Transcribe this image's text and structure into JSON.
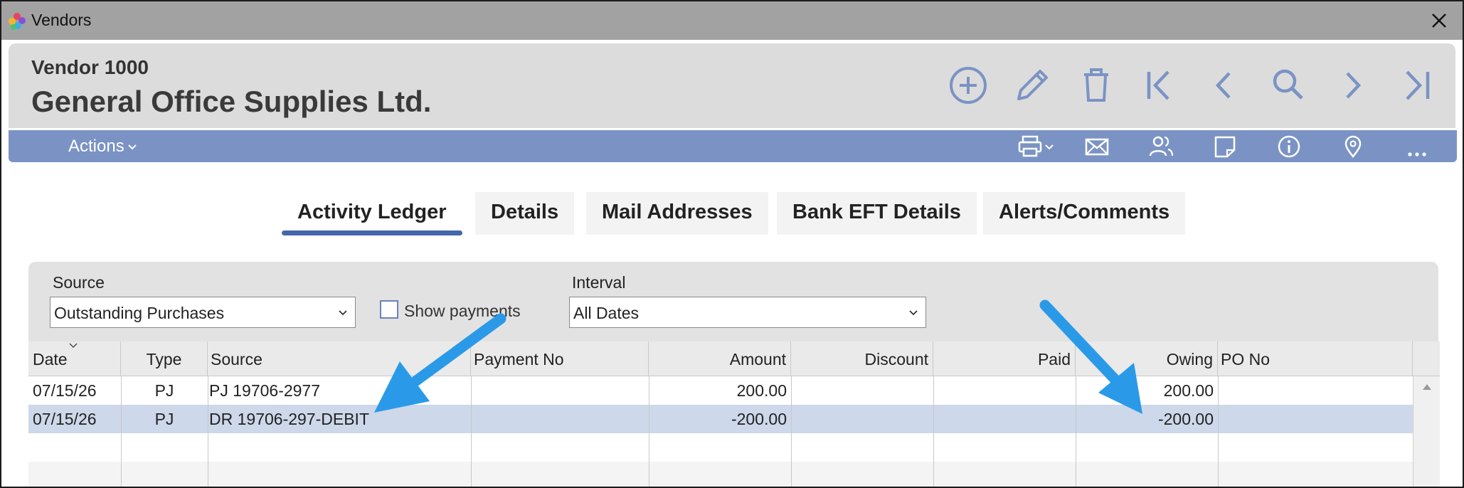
{
  "window": {
    "title": "Vendors"
  },
  "header": {
    "vendor_number": "Vendor 1000",
    "vendor_name": "General Office Supplies Ltd."
  },
  "action_bar": {
    "actions_label": "Actions"
  },
  "tabs": [
    {
      "label": "Activity Ledger",
      "active": true
    },
    {
      "label": "Details"
    },
    {
      "label": "Mail Addresses"
    },
    {
      "label": "Bank EFT Details"
    },
    {
      "label": "Alerts/Comments"
    }
  ],
  "filters": {
    "source_label": "Source",
    "source_value": "Outstanding Purchases",
    "show_payments_label": "Show payments",
    "show_payments_checked": false,
    "interval_label": "Interval",
    "interval_value": "All Dates"
  },
  "ledger": {
    "columns": [
      "Date",
      "Type",
      "Source",
      "Payment No",
      "Amount",
      "Discount",
      "Paid",
      "Owing",
      "PO No"
    ],
    "rows": [
      {
        "date": "07/15/26",
        "type": "PJ",
        "source": "PJ 19706-2977",
        "payment_no": "",
        "amount": "200.00",
        "discount": "",
        "paid": "",
        "owing": "200.00",
        "po_no": ""
      },
      {
        "date": "07/15/26",
        "type": "PJ",
        "source": "DR 19706-297-DEBIT",
        "payment_no": "",
        "amount": "-200.00",
        "discount": "",
        "paid": "",
        "owing": "-200.00",
        "po_no": ""
      }
    ]
  },
  "colors": {
    "accent": "#7b93c4",
    "icon": "#7b93c4",
    "selection": "#cdd8ea",
    "annotation_arrow": "#2a9ae8"
  }
}
